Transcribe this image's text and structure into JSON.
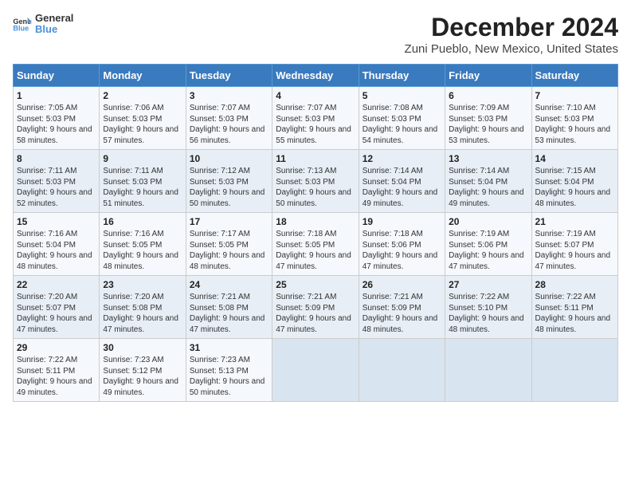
{
  "logo": {
    "general": "General",
    "blue": "Blue"
  },
  "header": {
    "month": "December 2024",
    "location": "Zuni Pueblo, New Mexico, United States"
  },
  "weekdays": [
    "Sunday",
    "Monday",
    "Tuesday",
    "Wednesday",
    "Thursday",
    "Friday",
    "Saturday"
  ],
  "weeks": [
    [
      {
        "day": "1",
        "sunrise": "7:05 AM",
        "sunset": "5:03 PM",
        "daylight": "9 hours and 58 minutes."
      },
      {
        "day": "2",
        "sunrise": "7:06 AM",
        "sunset": "5:03 PM",
        "daylight": "9 hours and 57 minutes."
      },
      {
        "day": "3",
        "sunrise": "7:07 AM",
        "sunset": "5:03 PM",
        "daylight": "9 hours and 56 minutes."
      },
      {
        "day": "4",
        "sunrise": "7:07 AM",
        "sunset": "5:03 PM",
        "daylight": "9 hours and 55 minutes."
      },
      {
        "day": "5",
        "sunrise": "7:08 AM",
        "sunset": "5:03 PM",
        "daylight": "9 hours and 54 minutes."
      },
      {
        "day": "6",
        "sunrise": "7:09 AM",
        "sunset": "5:03 PM",
        "daylight": "9 hours and 53 minutes."
      },
      {
        "day": "7",
        "sunrise": "7:10 AM",
        "sunset": "5:03 PM",
        "daylight": "9 hours and 53 minutes."
      }
    ],
    [
      {
        "day": "8",
        "sunrise": "7:11 AM",
        "sunset": "5:03 PM",
        "daylight": "9 hours and 52 minutes."
      },
      {
        "day": "9",
        "sunrise": "7:11 AM",
        "sunset": "5:03 PM",
        "daylight": "9 hours and 51 minutes."
      },
      {
        "day": "10",
        "sunrise": "7:12 AM",
        "sunset": "5:03 PM",
        "daylight": "9 hours and 50 minutes."
      },
      {
        "day": "11",
        "sunrise": "7:13 AM",
        "sunset": "5:03 PM",
        "daylight": "9 hours and 50 minutes."
      },
      {
        "day": "12",
        "sunrise": "7:14 AM",
        "sunset": "5:04 PM",
        "daylight": "9 hours and 49 minutes."
      },
      {
        "day": "13",
        "sunrise": "7:14 AM",
        "sunset": "5:04 PM",
        "daylight": "9 hours and 49 minutes."
      },
      {
        "day": "14",
        "sunrise": "7:15 AM",
        "sunset": "5:04 PM",
        "daylight": "9 hours and 48 minutes."
      }
    ],
    [
      {
        "day": "15",
        "sunrise": "7:16 AM",
        "sunset": "5:04 PM",
        "daylight": "9 hours and 48 minutes."
      },
      {
        "day": "16",
        "sunrise": "7:16 AM",
        "sunset": "5:05 PM",
        "daylight": "9 hours and 48 minutes."
      },
      {
        "day": "17",
        "sunrise": "7:17 AM",
        "sunset": "5:05 PM",
        "daylight": "9 hours and 48 minutes."
      },
      {
        "day": "18",
        "sunrise": "7:18 AM",
        "sunset": "5:05 PM",
        "daylight": "9 hours and 47 minutes."
      },
      {
        "day": "19",
        "sunrise": "7:18 AM",
        "sunset": "5:06 PM",
        "daylight": "9 hours and 47 minutes."
      },
      {
        "day": "20",
        "sunrise": "7:19 AM",
        "sunset": "5:06 PM",
        "daylight": "9 hours and 47 minutes."
      },
      {
        "day": "21",
        "sunrise": "7:19 AM",
        "sunset": "5:07 PM",
        "daylight": "9 hours and 47 minutes."
      }
    ],
    [
      {
        "day": "22",
        "sunrise": "7:20 AM",
        "sunset": "5:07 PM",
        "daylight": "9 hours and 47 minutes."
      },
      {
        "day": "23",
        "sunrise": "7:20 AM",
        "sunset": "5:08 PM",
        "daylight": "9 hours and 47 minutes."
      },
      {
        "day": "24",
        "sunrise": "7:21 AM",
        "sunset": "5:08 PM",
        "daylight": "9 hours and 47 minutes."
      },
      {
        "day": "25",
        "sunrise": "7:21 AM",
        "sunset": "5:09 PM",
        "daylight": "9 hours and 47 minutes."
      },
      {
        "day": "26",
        "sunrise": "7:21 AM",
        "sunset": "5:09 PM",
        "daylight": "9 hours and 48 minutes."
      },
      {
        "day": "27",
        "sunrise": "7:22 AM",
        "sunset": "5:10 PM",
        "daylight": "9 hours and 48 minutes."
      },
      {
        "day": "28",
        "sunrise": "7:22 AM",
        "sunset": "5:11 PM",
        "daylight": "9 hours and 48 minutes."
      }
    ],
    [
      {
        "day": "29",
        "sunrise": "7:22 AM",
        "sunset": "5:11 PM",
        "daylight": "9 hours and 49 minutes."
      },
      {
        "day": "30",
        "sunrise": "7:23 AM",
        "sunset": "5:12 PM",
        "daylight": "9 hours and 49 minutes."
      },
      {
        "day": "31",
        "sunrise": "7:23 AM",
        "sunset": "5:13 PM",
        "daylight": "9 hours and 50 minutes."
      },
      null,
      null,
      null,
      null
    ]
  ],
  "labels": {
    "sunrise": "Sunrise:",
    "sunset": "Sunset:",
    "daylight": "Daylight:"
  }
}
